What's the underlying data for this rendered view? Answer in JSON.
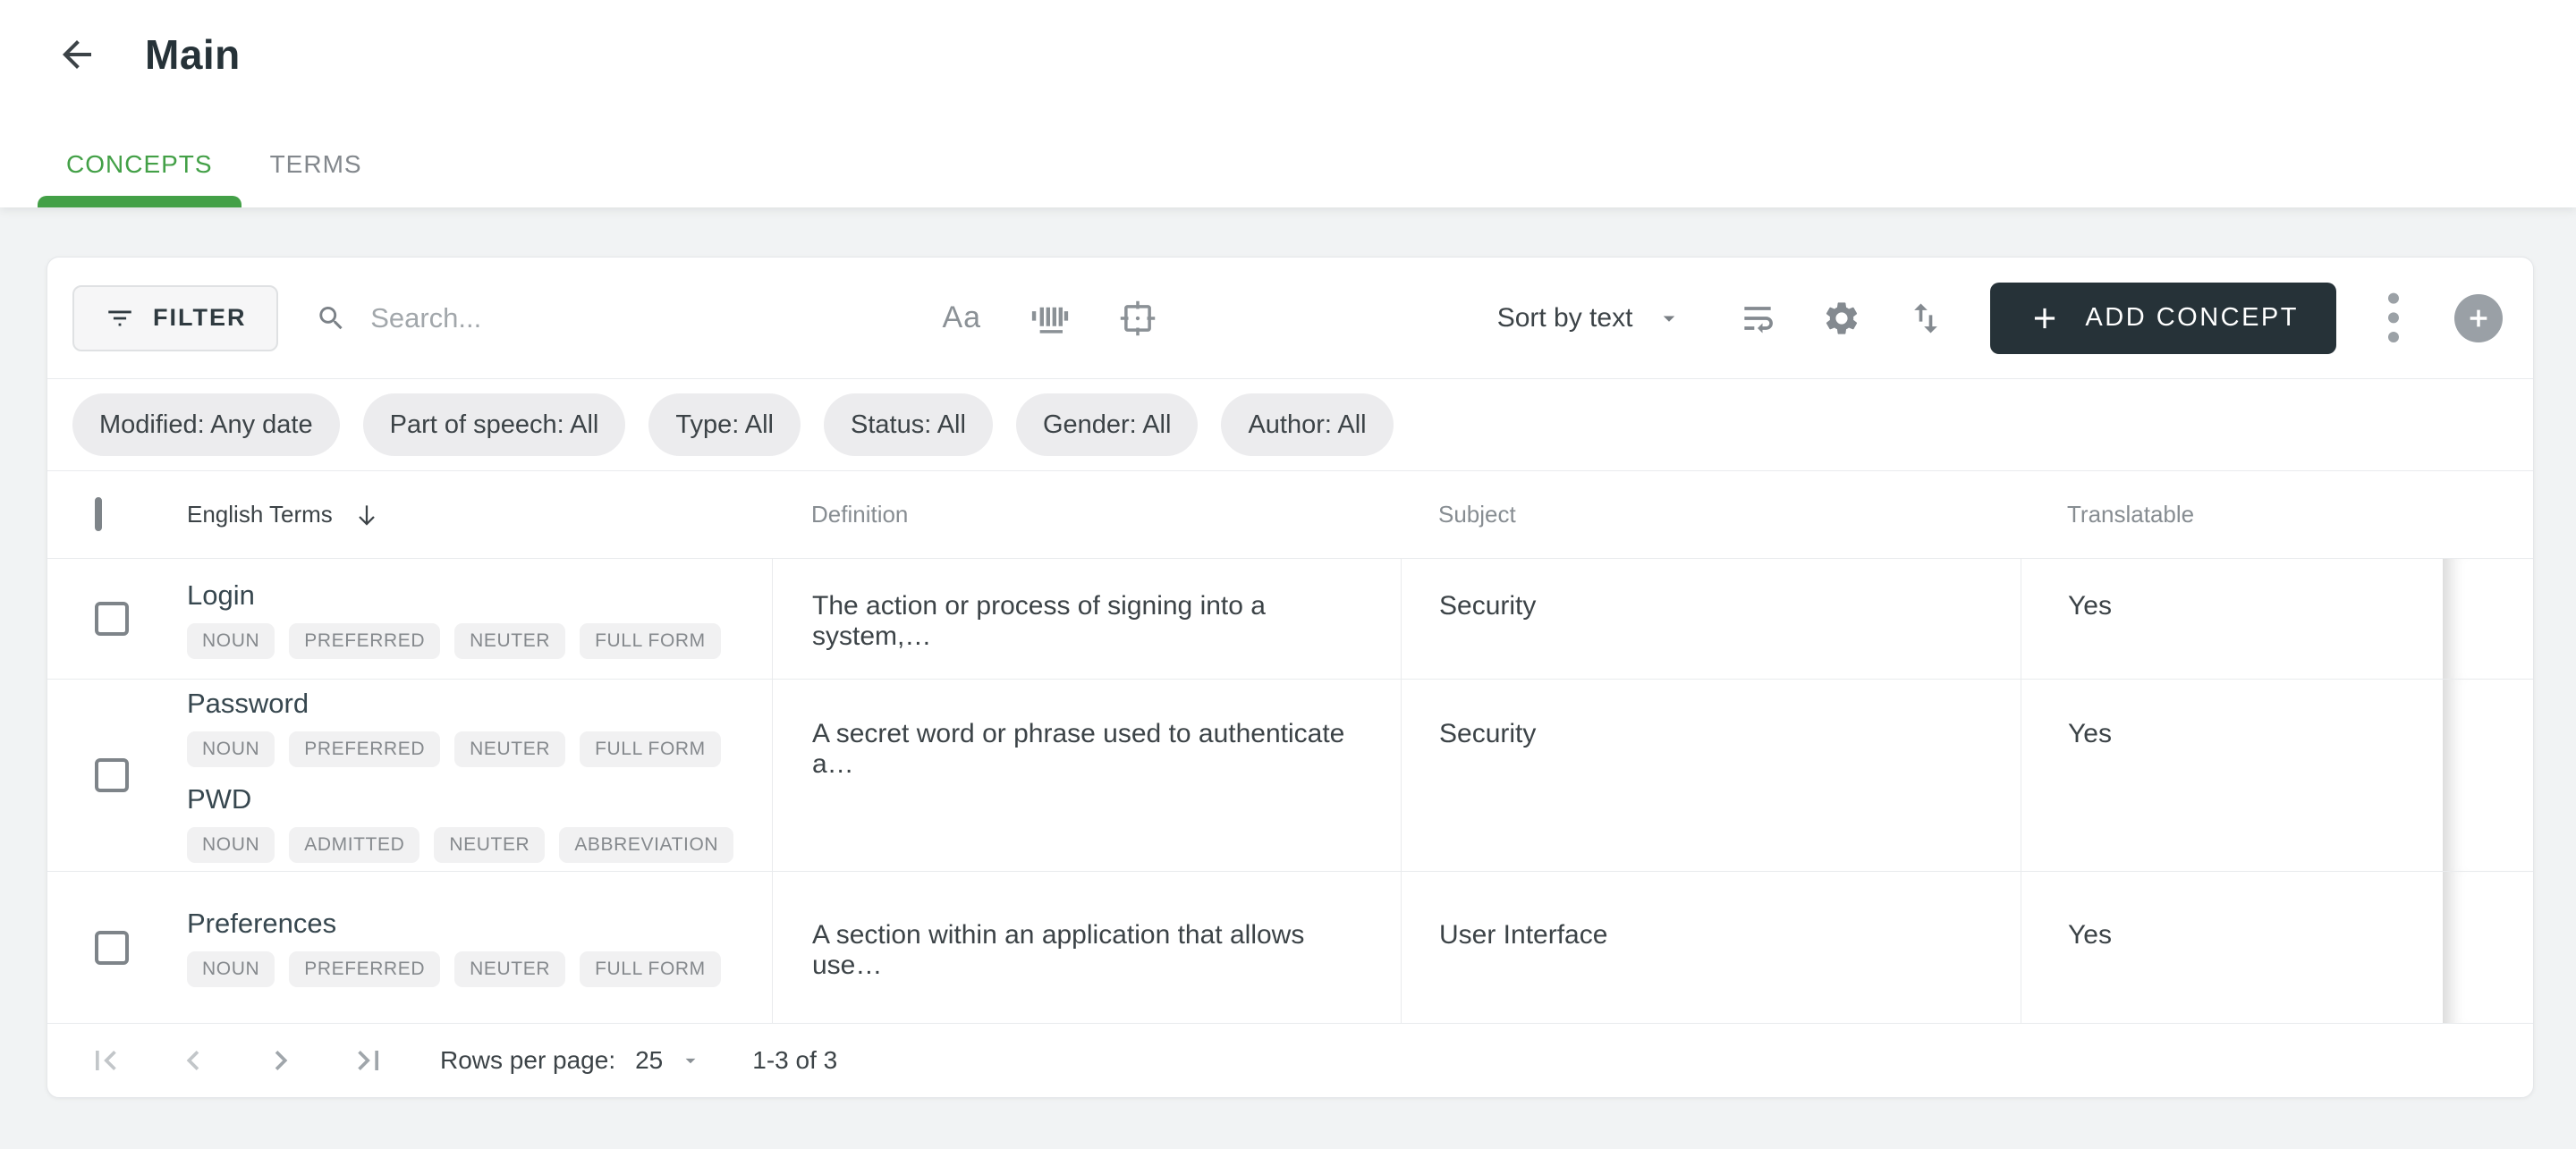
{
  "header": {
    "title": "Main",
    "tabs": [
      {
        "label": "CONCEPTS",
        "active": true
      },
      {
        "label": "TERMS",
        "active": false
      }
    ]
  },
  "toolbar": {
    "filter_label": "FILTER",
    "search_placeholder": "Search...",
    "match_case_label": "Aa",
    "sort_label": "Sort by text",
    "add_concept_label": "ADD CONCEPT"
  },
  "filter_chips": [
    "Modified: Any date",
    "Part of speech: All",
    "Type: All",
    "Status: All",
    "Gender: All",
    "Author: All"
  ],
  "table": {
    "columns": [
      "English Terms",
      "Definition",
      "Subject",
      "Translatable"
    ],
    "rows": [
      {
        "terms": [
          {
            "text": "Login",
            "tags": [
              "NOUN",
              "PREFERRED",
              "NEUTER",
              "FULL FORM"
            ]
          }
        ],
        "definition": "The action or process of signing into a system,…",
        "subject": "Security",
        "translatable": "Yes"
      },
      {
        "terms": [
          {
            "text": "Password",
            "tags": [
              "NOUN",
              "PREFERRED",
              "NEUTER",
              "FULL FORM"
            ]
          },
          {
            "text": "PWD",
            "tags": [
              "NOUN",
              "ADMITTED",
              "NEUTER",
              "ABBREVIATION"
            ]
          }
        ],
        "definition": "A secret word or phrase used to authenticate a…",
        "subject": "Security",
        "translatable": "Yes"
      },
      {
        "terms": [
          {
            "text": "Preferences",
            "tags": [
              "NOUN",
              "PREFERRED",
              "NEUTER",
              "FULL FORM"
            ]
          }
        ],
        "definition": "A section within an application that allows use…",
        "subject": "User Interface",
        "translatable": "Yes"
      }
    ]
  },
  "pagination": {
    "rows_per_page_label": "Rows per page:",
    "rows_per_page_value": "25",
    "range_label": "1-3 of 3"
  },
  "colors": {
    "accent_green": "#43A047",
    "button_dark": "#263238",
    "page_background": "#f1f3f4",
    "chip_background": "#ececee",
    "tag_background": "#f1f1f2"
  }
}
